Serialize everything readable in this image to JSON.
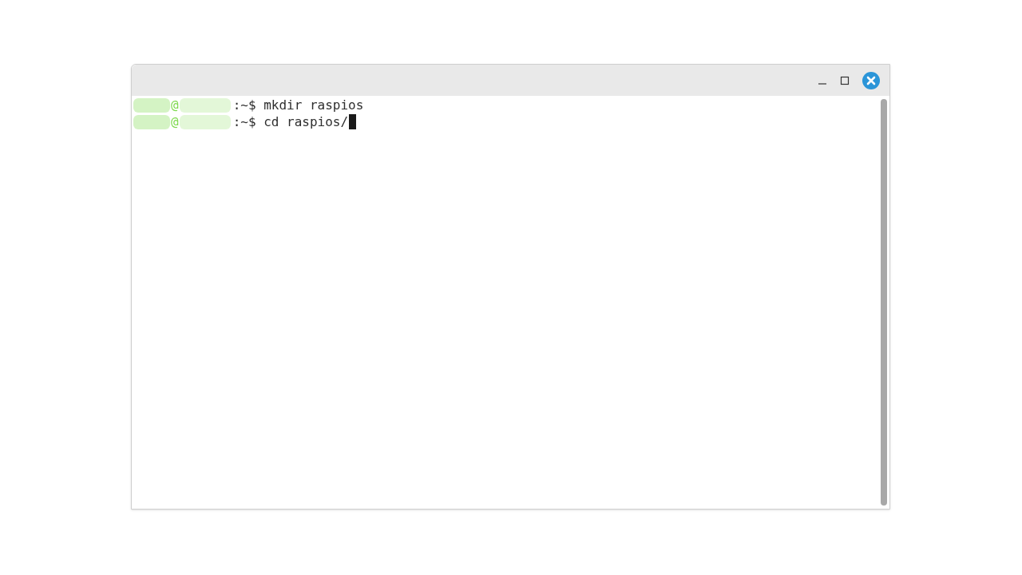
{
  "window": {
    "controls": [
      {
        "kind": "minimize"
      },
      {
        "kind": "maximize"
      },
      {
        "kind": "close"
      }
    ]
  },
  "terminal": {
    "lines": [
      {
        "at": "@",
        "prompt": ":~$",
        "command": "mkdir raspios",
        "cursor": false
      },
      {
        "at": "@",
        "prompt": ":~$",
        "command": "cd raspios/",
        "cursor": true
      }
    ]
  }
}
